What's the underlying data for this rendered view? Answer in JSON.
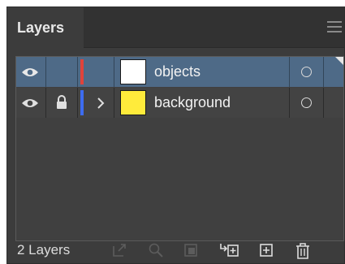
{
  "panel": {
    "tab_label": "Layers",
    "menu_icon": "hamburger-menu-icon"
  },
  "layers": [
    {
      "name": "objects",
      "selected": true,
      "visible": true,
      "locked": false,
      "expandable": false,
      "color": "#e0433b",
      "thumb_color": "#ffffff"
    },
    {
      "name": "background",
      "selected": false,
      "visible": true,
      "locked": true,
      "expandable": true,
      "color": "#3d6cf0",
      "thumb_color": "#ffeb3b"
    }
  ],
  "footer": {
    "count_label": "2 Layers",
    "buttons": [
      {
        "icon": "export-icon",
        "enabled": false
      },
      {
        "icon": "locate-object-icon",
        "enabled": false
      },
      {
        "icon": "make-clipping-mask-icon",
        "enabled": false
      },
      {
        "icon": "create-sublayer-icon",
        "enabled": true
      },
      {
        "icon": "create-new-layer-icon",
        "enabled": true
      },
      {
        "icon": "delete-icon",
        "enabled": true
      }
    ]
  },
  "colors": {
    "panel_bg": "#3c3c3c",
    "selected_row": "#4e6a87"
  }
}
